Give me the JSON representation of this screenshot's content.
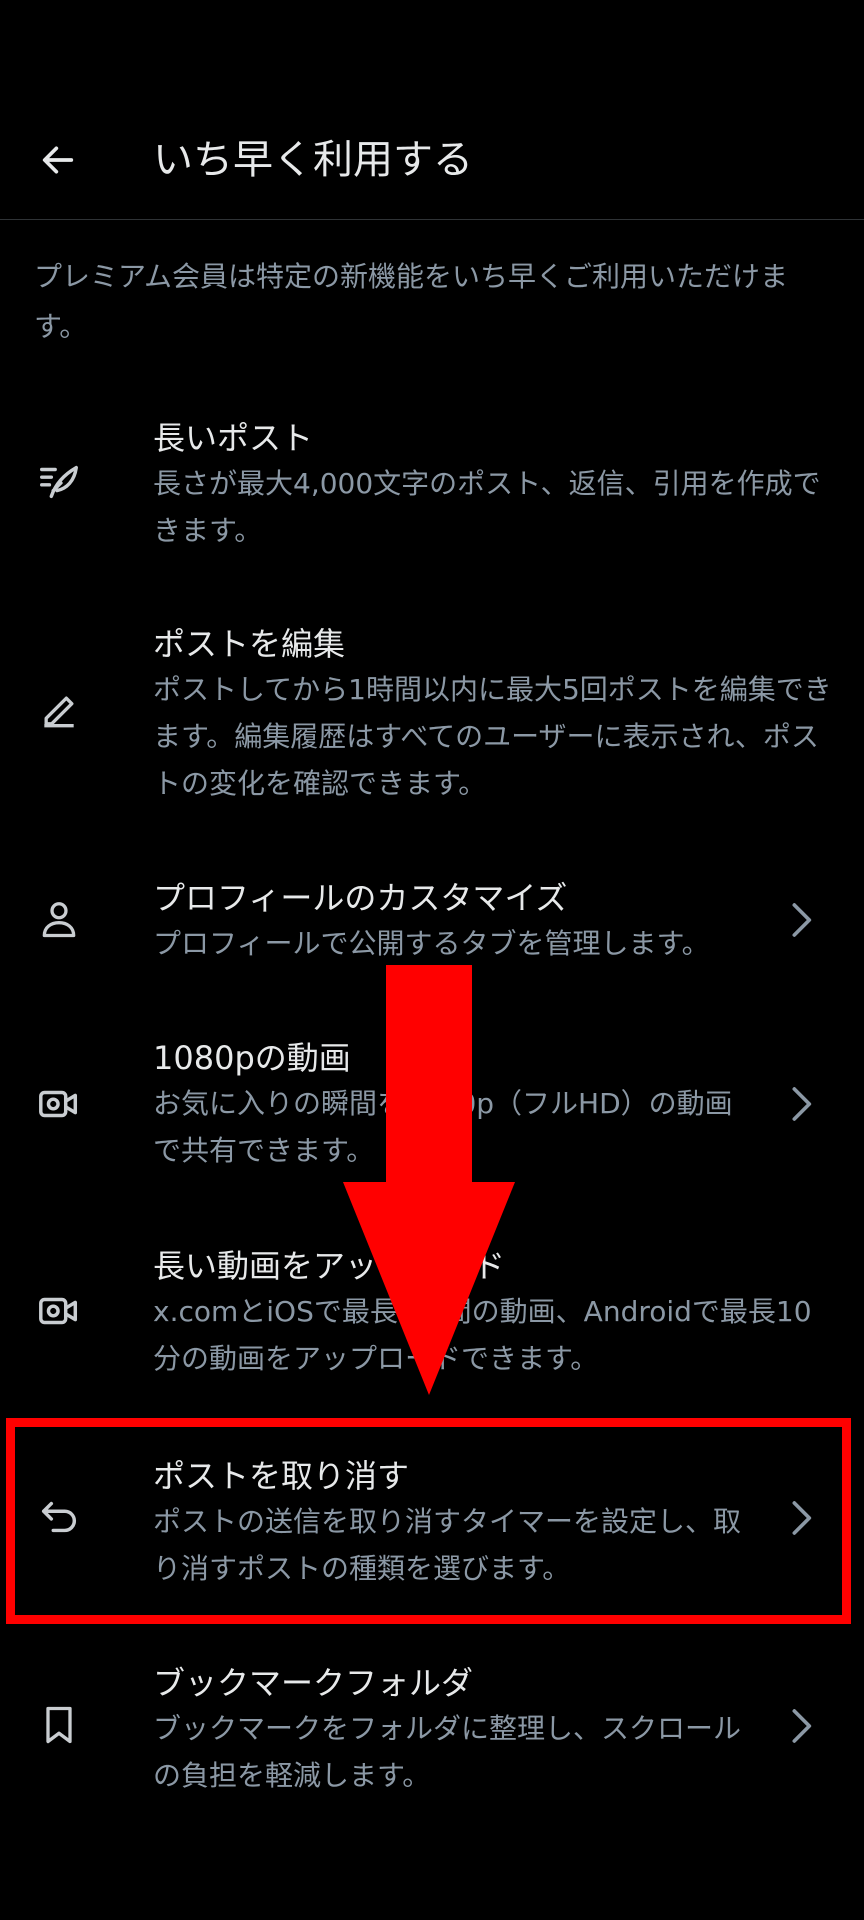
{
  "header": {
    "title": "いち早く利用する",
    "back_icon": "arrow-left-icon"
  },
  "intro": "プレミアム会員は特定の新機能をいち早くご利用いただけます。",
  "items": [
    {
      "label": "長いポスト",
      "description": "長さが最大4,000文字のポスト、返信、引用を作成できます。",
      "icon": "feather-lines-icon",
      "has_chevron": false
    },
    {
      "label": "ポストを編集",
      "description": "ポストしてから1時間以内に最大5回ポストを編集できます。編集履歴はすべてのユーザーに表示され、ポストの変化を確認できます。",
      "icon": "pencil-icon",
      "has_chevron": false
    },
    {
      "label": "プロフィールのカスタマイズ",
      "description": "プロフィールで公開するタブを管理します。",
      "icon": "person-icon",
      "has_chevron": true
    },
    {
      "label": "1080pの動画",
      "description": "お気に入りの瞬間を1080p（フルHD）の動画で共有できます。",
      "icon": "video-camera-icon",
      "has_chevron": true
    },
    {
      "label": "長い動画をアップロード",
      "description": "x.comとiOSで最長3時間の動画、Androidで最長10分の動画をアップロードできます。",
      "icon": "video-camera-icon",
      "has_chevron": false
    },
    {
      "label": "ポストを取り消す",
      "description": "ポストの送信を取り消すタイマーを設定し、取り消すポストの種類を選びます。",
      "icon": "undo-icon",
      "has_chevron": true
    },
    {
      "label": "ブックマークフォルダ",
      "description": "ブックマークをフォルダに整理し、スクロールの負担を軽減します。",
      "icon": "bookmark-icon",
      "has_chevron": true
    }
  ],
  "annotation": {
    "highlight_color": "#ff0000",
    "arrow_color": "#ff0000"
  },
  "colors": {
    "background": "#000000",
    "text_primary": "#e7e9ea",
    "text_secondary": "#8b98a5",
    "divider": "#2f3336"
  }
}
